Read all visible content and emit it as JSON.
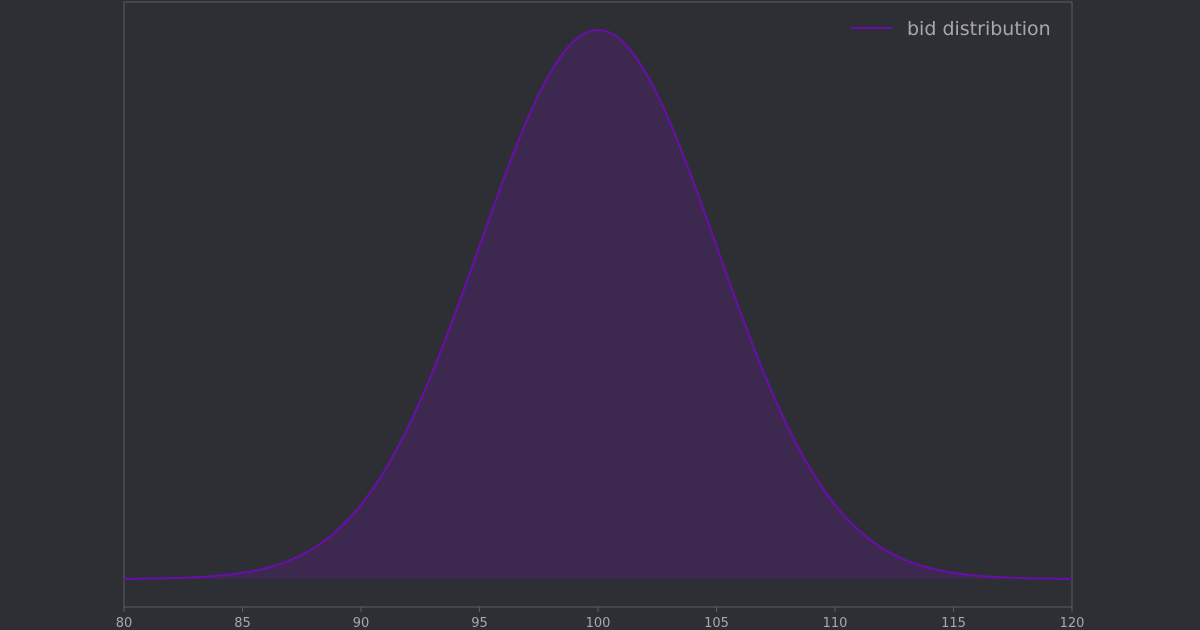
{
  "chart_data": {
    "type": "area",
    "x_range": [
      80,
      120
    ],
    "x_ticks": [
      80,
      85,
      90,
      95,
      100,
      105,
      110,
      115,
      120
    ],
    "x_tick_labels": [
      "80",
      "85",
      "90",
      "95",
      "100",
      "105",
      "110",
      "115",
      "120"
    ],
    "y_range": [
      0,
      1.05
    ],
    "grid": false,
    "legend_position": "top-right",
    "series": [
      {
        "name": "bid distribution",
        "distribution": "normal",
        "mean": 100,
        "std": 5,
        "color": "#6a0dad",
        "fill_color": "#3d2850"
      }
    ],
    "x": [
      80,
      82,
      84,
      86,
      88,
      90,
      91,
      92,
      93,
      94,
      95,
      96,
      97,
      98,
      99,
      100,
      101,
      102,
      103,
      104,
      105,
      106,
      107,
      108,
      109,
      110,
      112,
      114,
      116,
      118,
      120
    ],
    "y": [
      0.0003,
      0.0015,
      0.006,
      0.02,
      0.056,
      0.135,
      0.198,
      0.278,
      0.375,
      0.487,
      0.607,
      0.726,
      0.835,
      0.923,
      0.98,
      1.0,
      0.98,
      0.923,
      0.835,
      0.726,
      0.607,
      0.487,
      0.375,
      0.278,
      0.198,
      0.135,
      0.056,
      0.02,
      0.006,
      0.0015,
      0.0003
    ],
    "xlabel": "",
    "ylabel": "",
    "title": ""
  },
  "colors": {
    "background": "#2e2f34",
    "axes_frame": "#5c5d62",
    "tick_text": "#a8a8a8",
    "legend_text": "#a8a8a8"
  }
}
